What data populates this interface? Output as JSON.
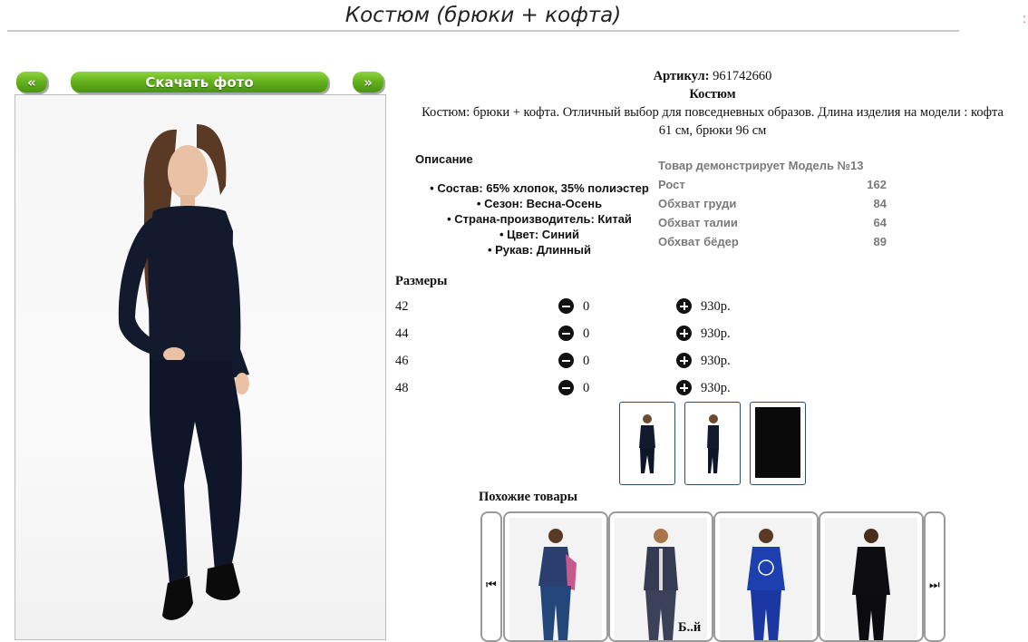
{
  "page_title": "Костюм (брюки + кофта)",
  "corner_mark": ":",
  "gallery": {
    "prev_label": "«",
    "download_label": "Скачать фото",
    "next_label": "»"
  },
  "product": {
    "article_label": "Артикул:",
    "article_value": "961742660",
    "name": "Костюм",
    "description_line1": "Костюм: брюки + кофта. Отличный выбор для повседневных образов. Длина изделия на модели : кофта",
    "description_line2": "61 см, брюки 96 см"
  },
  "description": {
    "heading": "Описание",
    "attributes": [
      "Состав: 65% хлопок, 35% полиэстер",
      "Сезон: Весна-Осень",
      "Страна-производитель: Китай",
      "Цвет: Синий",
      "Рукав: Длинный"
    ]
  },
  "model": {
    "heading": "Товар демонстрирует Модель №13",
    "rows": [
      {
        "label": "Рост",
        "value": "162"
      },
      {
        "label": "Обхват груди",
        "value": "84"
      },
      {
        "label": "Обхват талии",
        "value": "64"
      },
      {
        "label": "Обхват бёдер",
        "value": "89"
      }
    ]
  },
  "sizes": {
    "heading": "Размеры",
    "rows": [
      {
        "size": "42",
        "qty": "0",
        "price": "930р."
      },
      {
        "size": "44",
        "qty": "0",
        "price": "930р."
      },
      {
        "size": "46",
        "qty": "0",
        "price": "930р."
      },
      {
        "size": "48",
        "qty": "0",
        "price": "930р."
      }
    ]
  },
  "similar": {
    "heading": "Похожие товары"
  },
  "bottom_fragment": "Б..й",
  "colors": {
    "button_green": "#63b01c",
    "suit_navy": "#141a2e",
    "muted_gray": "#7a7a7a"
  }
}
